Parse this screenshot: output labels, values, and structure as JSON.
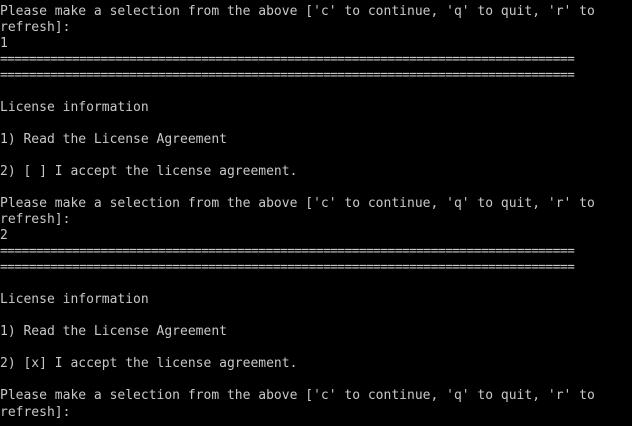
{
  "terminal": {
    "lines": [
      {
        "kind": "text",
        "text": "Please make a selection from the above ['c' to continue, 'q' to quit, 'r' to"
      },
      {
        "kind": "text",
        "text": "refresh]:"
      },
      {
        "kind": "text",
        "text": "1"
      },
      {
        "kind": "sep",
        "text": "================================================================================"
      },
      {
        "kind": "sep",
        "text": "================================================================================"
      },
      {
        "kind": "blank",
        "text": ""
      },
      {
        "kind": "text",
        "text": "License information"
      },
      {
        "kind": "blank",
        "text": ""
      },
      {
        "kind": "text",
        "text": "1) Read the License Agreement"
      },
      {
        "kind": "blank",
        "text": ""
      },
      {
        "kind": "text",
        "text": "2) [ ] I accept the license agreement."
      },
      {
        "kind": "blank",
        "text": ""
      },
      {
        "kind": "text",
        "text": "Please make a selection from the above ['c' to continue, 'q' to quit, 'r' to"
      },
      {
        "kind": "text",
        "text": "refresh]:"
      },
      {
        "kind": "text",
        "text": "2"
      },
      {
        "kind": "sep",
        "text": "================================================================================"
      },
      {
        "kind": "sep",
        "text": "================================================================================"
      },
      {
        "kind": "blank",
        "text": ""
      },
      {
        "kind": "text",
        "text": "License information"
      },
      {
        "kind": "blank",
        "text": ""
      },
      {
        "kind": "text",
        "text": "1) Read the License Agreement"
      },
      {
        "kind": "blank",
        "text": ""
      },
      {
        "kind": "text",
        "text": "2) [x] I accept the license agreement."
      },
      {
        "kind": "blank",
        "text": ""
      },
      {
        "kind": "text",
        "text": "Please make a selection from the above ['c' to continue, 'q' to quit, 'r' to"
      },
      {
        "kind": "text",
        "text": "refresh]:"
      }
    ],
    "colors": {
      "background": "#000000",
      "foreground": "#c8c8c8"
    }
  }
}
